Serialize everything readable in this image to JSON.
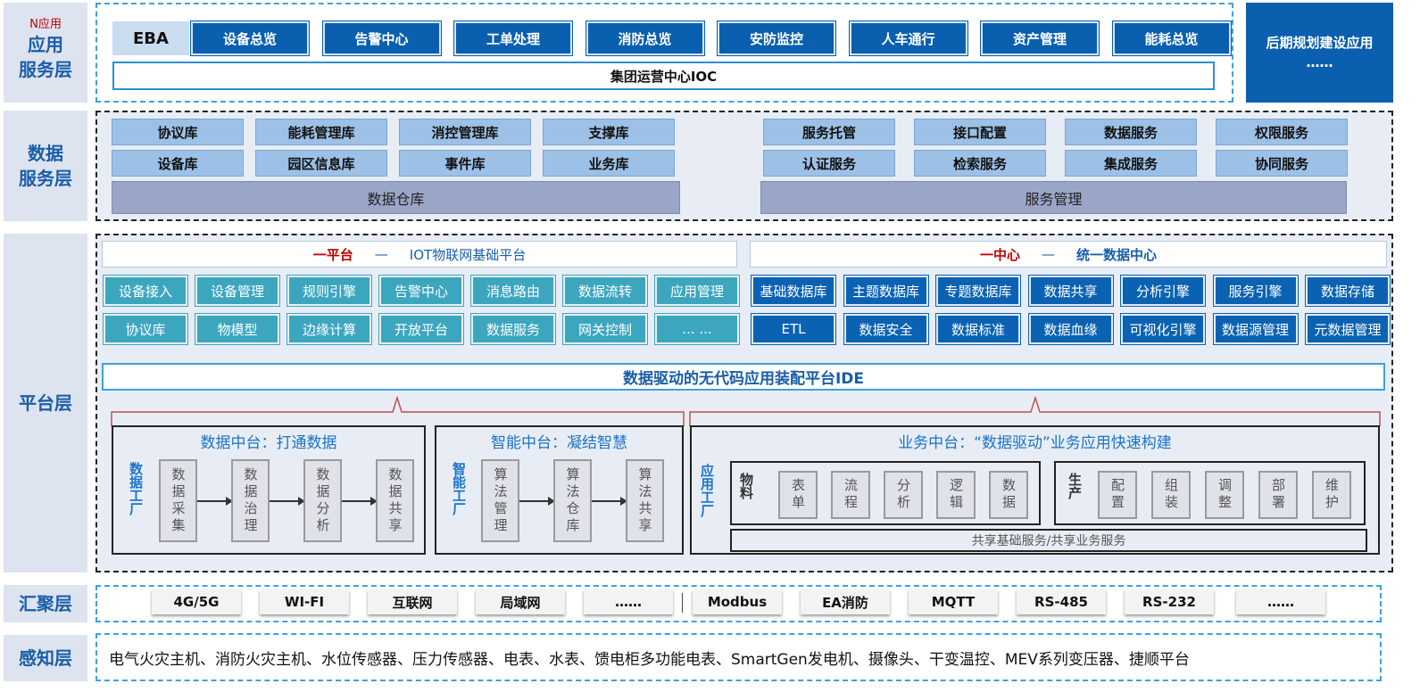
{
  "layers": {
    "app": {
      "tag": "N应用",
      "line1": "应用",
      "line2": "服务层"
    },
    "data": {
      "line1": "数据",
      "line2": "服务层"
    },
    "platform": {
      "label": "平台层"
    },
    "converge": {
      "label": "汇聚层"
    },
    "sense": {
      "label": "感知层"
    }
  },
  "app_layer": {
    "eba": "EBA",
    "modules": [
      "设备总览",
      "告警中心",
      "工单处理",
      "消防总览",
      "安防监控",
      "人车通行",
      "资产管理",
      "能耗总览"
    ],
    "ioc": "集团运营中心IOC",
    "future_line1": "后期规划建设应用",
    "future_line2": "……"
  },
  "data_layer": {
    "left_row1": [
      "协议库",
      "能耗管理库",
      "消控管理库",
      "支撑库"
    ],
    "left_row2": [
      "设备库",
      "园区信息库",
      "事件库",
      "业务库"
    ],
    "warehouse": "数据仓库",
    "right_row1": [
      "服务托管",
      "接口配置",
      "数据服务",
      "权限服务"
    ],
    "right_row2": [
      "认证服务",
      "检索服务",
      "集成服务",
      "协同服务"
    ],
    "service_mgmt": "服务管理"
  },
  "platform_layer": {
    "iot_header": {
      "a": "一平台",
      "dash": "—",
      "b": "IOT物联网基础平台"
    },
    "iot_row1": [
      "设备接入",
      "设备管理",
      "规则引擎",
      "告警中心",
      "消息路由",
      "数据流转",
      "应用管理"
    ],
    "iot_row2": [
      "协议库",
      "物模型",
      "边缘计算",
      "开放平台",
      "数据服务",
      "网关控制",
      "... ..."
    ],
    "center_header": {
      "a": "一中心",
      "dash": "—",
      "b": "统一数据中心"
    },
    "center_row1": [
      "基础数据库",
      "主题数据库",
      "专题数据库",
      "数据共享",
      "分析引擎",
      "服务引擎",
      "数据存储"
    ],
    "center_row2": [
      "ETL",
      "数据安全",
      "数据标准",
      "数据血缘",
      "可视化引擎",
      "数据源管理",
      "元数据管理"
    ],
    "ide": "数据驱动的无代码应用装配平台IDE",
    "data_mid": {
      "title": "数据中台：打通数据",
      "factory": "数据工厂",
      "steps": [
        "数据采集",
        "数据治理",
        "数据分析",
        "数据共享"
      ]
    },
    "ai_mid": {
      "title": "智能中台：凝结智慧",
      "factory": "智能工厂",
      "steps": [
        "算法管理",
        "算法仓库",
        "算法共享"
      ]
    },
    "biz_mid": {
      "title": "业务中台：“数据驱动”业务应用快速构建",
      "factory": "应用工厂",
      "material_label": "物料",
      "materials": [
        "表单",
        "流程",
        "分析",
        "逻辑",
        "数据"
      ],
      "produce_label": "生产",
      "produce": [
        "配置",
        "组装",
        "调整",
        "部署",
        "维护"
      ],
      "shared": "共享基础服务/共享业务服务"
    }
  },
  "converge_layer": {
    "items": [
      "4G/5G",
      "WI-FI",
      "互联网",
      "局域网",
      "……",
      "Modbus",
      "EA消防",
      "MQTT",
      "RS-485",
      "RS-232",
      "……"
    ]
  },
  "sense_layer": {
    "text": "电气火灾主机、消防火灾主机、水位传感器、压力传感器、电表、水表、馈电柜多功能电表、SmartGen发电机、摄像头、干变温控、MEV系列变压器、捷顺平台"
  },
  "colors": {
    "dark_blue": "#0a5fae",
    "light_blue": "#9cc0e6",
    "teal": "#3da6bf",
    "label_bg": "#dde3ef",
    "label_text": "#1a5ea8",
    "red": "#c00000"
  }
}
